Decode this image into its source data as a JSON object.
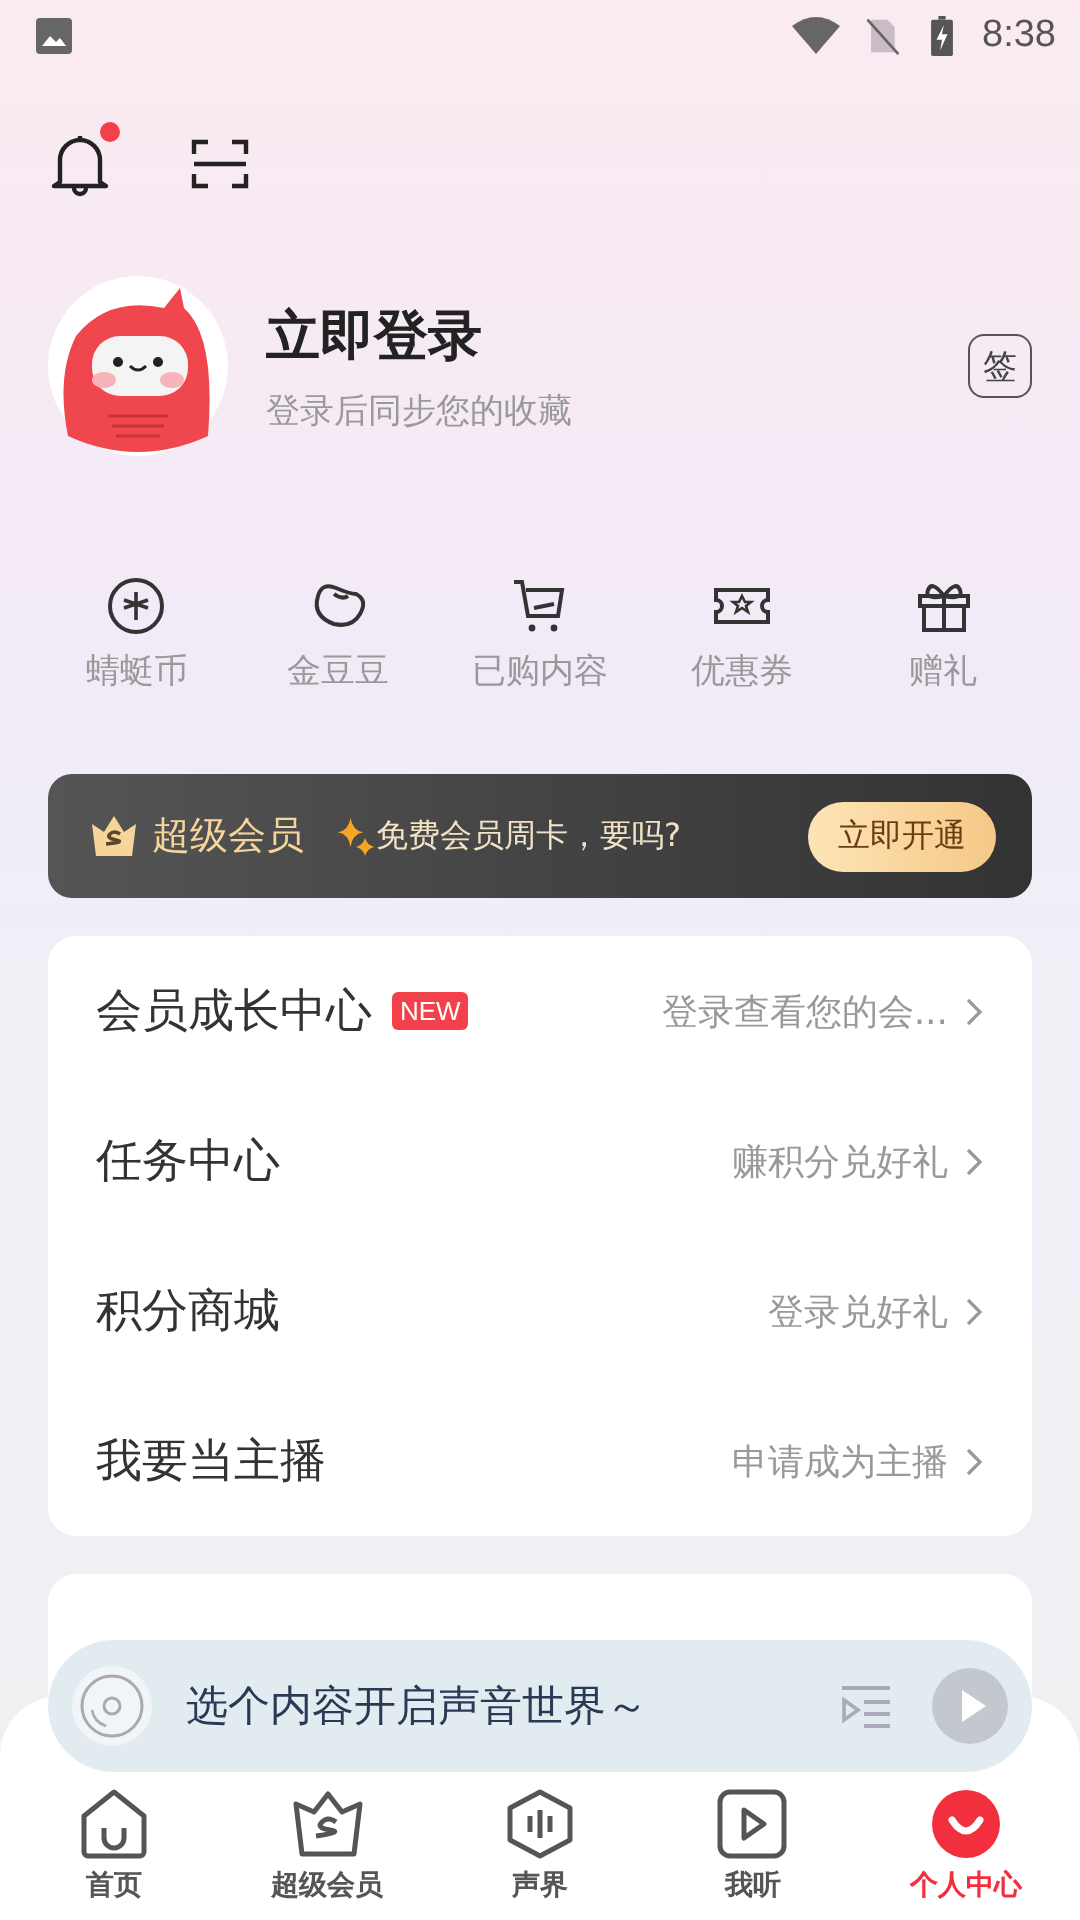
{
  "status_bar": {
    "time": "8:38"
  },
  "profile": {
    "title": "立即登录",
    "subtitle": "登录后同步您的收藏",
    "sign_label": "签",
    "has_notification": true
  },
  "shortcuts": [
    {
      "kind": "coin",
      "label": "蜻蜓币"
    },
    {
      "kind": "bean",
      "label": "金豆豆"
    },
    {
      "kind": "cart",
      "label": "已购内容"
    },
    {
      "kind": "coupon",
      "label": "优惠券"
    },
    {
      "kind": "gift",
      "label": "赠礼"
    }
  ],
  "vip_banner": {
    "title": "超级会员",
    "offer": "免费会员周卡，要吗?",
    "button": "立即开通"
  },
  "menu": [
    {
      "label": "会员成长中心",
      "badge": "NEW",
      "hint": "登录查看您的会..."
    },
    {
      "label": "任务中心",
      "hint": "赚积分兑好礼"
    },
    {
      "label": "积分商城",
      "hint": "登录兑好礼"
    },
    {
      "label": "我要当主播",
      "hint": "申请成为主播"
    }
  ],
  "mini_player": {
    "text": "选个内容开启声音世界～"
  },
  "tab_bar": [
    {
      "kind": "home",
      "label": "首页",
      "selected": false
    },
    {
      "kind": "vip",
      "label": "超级会员",
      "selected": false
    },
    {
      "kind": "hex",
      "label": "声界",
      "selected": false
    },
    {
      "kind": "play",
      "label": "我听",
      "selected": false
    },
    {
      "kind": "me",
      "label": "个人中心",
      "selected": true
    }
  ]
}
